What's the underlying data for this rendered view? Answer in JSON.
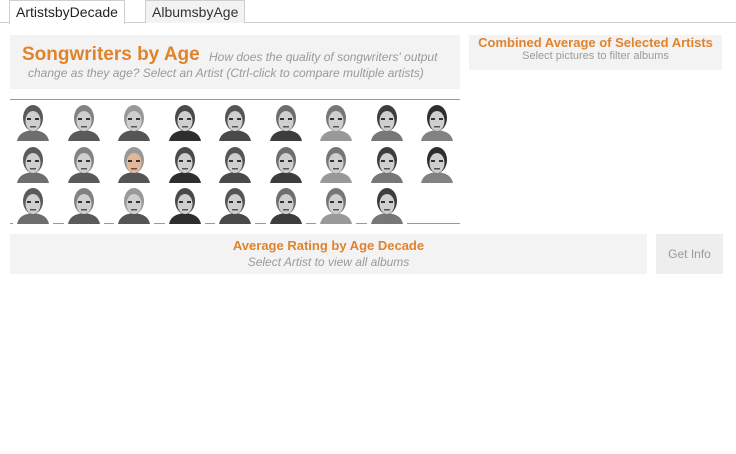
{
  "tabs": [
    {
      "label": "ArtistsbyDecade",
      "active": true
    },
    {
      "label": "AlbumsbyAge",
      "active": false
    }
  ],
  "header": {
    "title": "Songwriters by Age",
    "subtitle_line1": "How does the quality of songwriters' output",
    "subtitle_line2": "change as they age?   Select an Artist  (Ctrl-click to compare multiple artists)"
  },
  "combined": {
    "title": "Combined Average of Selected Artists",
    "subtitle": "Select pictures to filter albums"
  },
  "artist_grid": {
    "count": 26,
    "item_icon": "artist-portrait-icon"
  },
  "average_panel": {
    "title": "Average Rating  by Age Decade",
    "subtitle": "Select Artist to view all albums"
  },
  "get_info": {
    "label": "Get Info"
  },
  "colors": {
    "accent": "#e0832c",
    "muted_text": "#9a9a9a",
    "panel_bg": "#f3f3f3"
  }
}
